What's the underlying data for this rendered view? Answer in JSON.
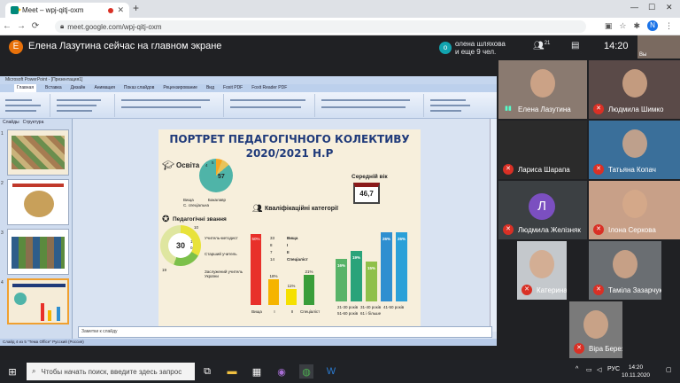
{
  "browser": {
    "tab_title": "Meet – wpj-qitj-oxm",
    "url": "meet.google.com/wpj-qitj-oxm",
    "profile_initial": "N"
  },
  "meet": {
    "presenter_initial": "Е",
    "presenter_text": "Елена Лазутина сейчас на главном экране",
    "raised_initial": "o",
    "raised_line1": "олена шляхова",
    "raised_line2": "и еще 9 чел.",
    "participants_count": "21",
    "time": "14:20",
    "self_label": "Вы"
  },
  "powerpoint": {
    "window_title": "Microsoft PowerPoint - [Презентация1]",
    "tabs": [
      "Главная",
      "Вставка",
      "Дизайн",
      "Анимация",
      "Показ слайдов",
      "Рецензирование",
      "Вид",
      "Foxit PDF",
      "Foxit Reader PDF"
    ],
    "pane_tabs": [
      "Слайды",
      "Структура"
    ],
    "thumb_numbers": [
      "1",
      "2",
      "3",
      "4"
    ],
    "notes_placeholder": "Заметки к слайду",
    "status": "Слайд 4 из 5   \"Тема Office\"   Русский (Россия)"
  },
  "slide": {
    "title_line1": "ПОРТРЕТ ПЕДАГОГІЧНОГО КОЛЕКТИВУ",
    "title_line2": "2020/2021 Н.Р",
    "education_label": "Освіта",
    "education_values": [
      57,
      4,
      5
    ],
    "education_legend": [
      "Вища",
      "Бакалавр",
      "С. спеціальна"
    ],
    "avg_age_label": "Середній вік",
    "avg_age_value": "46,7",
    "titles_label": "Педагогічні звання",
    "titles_center": "30",
    "titles_values": [
      "10",
      "1",
      "0",
      "19"
    ],
    "titles_legend": [
      "Учитель-методист",
      "Старший учитель",
      "Заслужений учитель України"
    ],
    "qual_label": "Кваліфікаційні категорії",
    "qual_numbers": [
      "33",
      "8",
      "7",
      "14"
    ],
    "qual_legend": [
      "Вища",
      "I",
      "II",
      "Спеціаліст"
    ],
    "qual_bars": [
      {
        "label": "Вища",
        "value": "50%",
        "pct": 50,
        "color": "#e8302a"
      },
      {
        "label": "I",
        "value": "18%",
        "pct": 18,
        "color": "#f5b400"
      },
      {
        "label": "II",
        "value": "11%",
        "pct": 11,
        "color": "#f5e000"
      },
      {
        "label": "Спеціаліст",
        "value": "21%",
        "pct": 21,
        "color": "#3a9e3a"
      }
    ],
    "age_bars": [
      {
        "value": "16%",
        "pct": 16,
        "color": "#58b368"
      },
      {
        "value": "19%",
        "pct": 19,
        "color": "#2aa37a"
      },
      {
        "value": "15%",
        "pct": 15,
        "color": "#8fc04a"
      },
      {
        "value": "26%",
        "pct": 26,
        "color": "#2f8fd0"
      },
      {
        "value": "26%",
        "pct": 26,
        "color": "#2aa0d8"
      }
    ],
    "age_legend": [
      "21-30 років",
      "31-40 років",
      "41-50 років",
      "51-60 років",
      "61 і більше"
    ]
  },
  "participants": [
    {
      "name": "Елена Лазутина",
      "mic": "on"
    },
    {
      "name": "Людмила Шимко",
      "mic": "off"
    },
    {
      "name": "Лариса Шарапа",
      "mic": "off"
    },
    {
      "name": "Татьяна Копач",
      "mic": "off"
    },
    {
      "name": "Людмила Желізняк",
      "mic": "off",
      "initial": "Л"
    },
    {
      "name": "Ілона Серкова",
      "mic": "off"
    },
    {
      "name": "Катерина Михайлик",
      "mic": "off"
    },
    {
      "name": "Таміла Зазарчук",
      "mic": "off"
    },
    {
      "name": "Віра Березюк",
      "mic": "off"
    }
  ],
  "taskbar": {
    "search_placeholder": "Чтобы начать поиск, введите здесь запрос",
    "lang": "РУС",
    "time": "14:20",
    "date": "10.11.2020"
  }
}
